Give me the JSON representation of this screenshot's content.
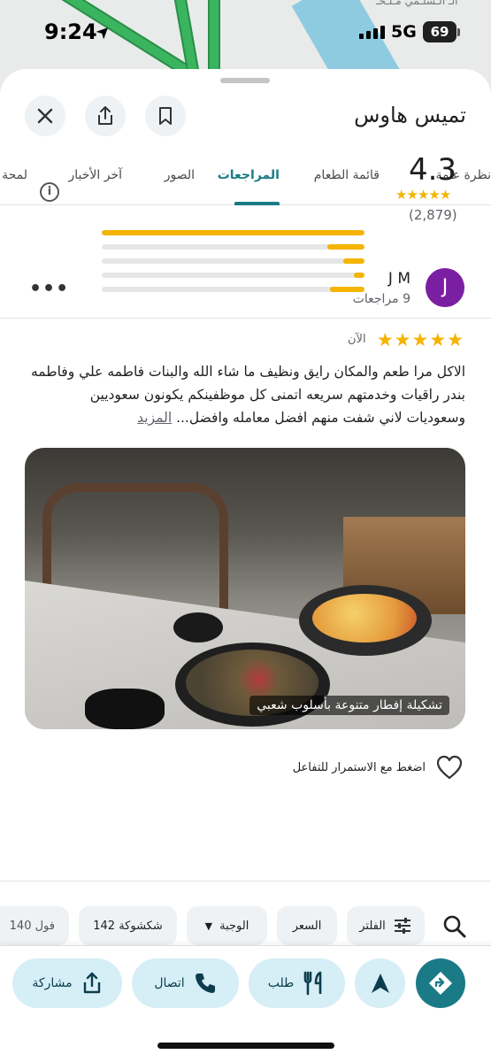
{
  "status": {
    "time": "9:24",
    "network": "5G",
    "battery": "69"
  },
  "map": {
    "label": "الـ الـسلـمي مـلـحـ"
  },
  "place": {
    "title": "تميس هاوس"
  },
  "tabs": [
    {
      "label": "نظرة عامة"
    },
    {
      "label": "قائمة الطعام"
    },
    {
      "label": "المراجعات",
      "active": true
    },
    {
      "label": "الصور"
    },
    {
      "label": "آخر الأخبار"
    },
    {
      "label": "لمحة"
    }
  ],
  "rating": {
    "value": "4.3",
    "stars": "★★★★★",
    "count": "(2,879)",
    "distribution": [
      1.0,
      0.14,
      0.08,
      0.04,
      0.13
    ]
  },
  "review": {
    "avatar_letter": "J",
    "author": "J M",
    "author_reviews": "9 مراجعات",
    "stars": "★★★★★",
    "time": "الآن",
    "text": "الاكل مرا طعم والمكان رايق ونظيف ما شاء الله والبنات فاطمه علي وفاطمه بندر راقيات وخدمتهم سريعه اتمنى كل موظفينكم يكونون سعوديين وسعوديات لاني شفت منهم افضل معامله وافضل...",
    "more_label": "المزيد",
    "photo_caption": "تشكيلة إفطار متنوعة بأسلوب شعبي",
    "like_prompt": "اضغط مع الاستمرار للتفاعل"
  },
  "filters": [
    {
      "label": "الفلتر"
    },
    {
      "label": "السعر"
    },
    {
      "label": "الوجبة"
    },
    {
      "label": "شكشوكة 142"
    },
    {
      "label": "فول 140"
    }
  ],
  "actions": [
    {
      "label": "طلب"
    },
    {
      "label": "اتصال"
    },
    {
      "label": "مشاركة"
    }
  ],
  "colors": {
    "accent": "#1a7b86",
    "star": "#f4b400",
    "avatar": "#7b1fa2",
    "action_bg": "#d6eef6"
  }
}
